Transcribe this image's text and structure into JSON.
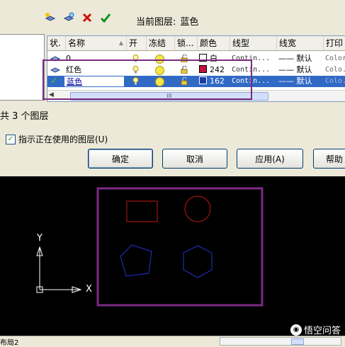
{
  "toolbar": {
    "icons": [
      "new-layer-icon",
      "new-layer-frozen-icon",
      "delete-layer-icon",
      "set-current-icon"
    ],
    "current_layer_label": "当前图层:",
    "current_layer_value": "蓝色"
  },
  "left_pane": {
    "text": ""
  },
  "grid": {
    "headers": [
      "状.",
      "名称",
      "▲",
      "开",
      "冻结",
      "锁...",
      "颜色",
      "线型",
      "线宽",
      "打印"
    ],
    "rows": [
      {
        "status": "",
        "name": "0",
        "color_name": "白",
        "color_hex": "#ffffff",
        "linetype": "Contin...",
        "lineweight": "—— 默认",
        "plot": "Color"
      },
      {
        "status": "",
        "name": "红色",
        "color_name": "242",
        "color_hex": "#c0143c",
        "linetype": "Contin...",
        "lineweight": "—— 默认",
        "plot": "Colo..."
      },
      {
        "status": "✓",
        "name": "蓝色",
        "color_name": "162",
        "color_hex": "#1c3aa8",
        "linetype": "Contin...",
        "lineweight": "—— 默认",
        "plot": "Colo..."
      }
    ],
    "scroll_thumb_label": "III"
  },
  "footer": {
    "layer_count": "共 3 个图层",
    "show_used_label": "指示正在使用的图层(U)"
  },
  "buttons": {
    "ok": "确定",
    "cancel": "取消",
    "apply": "应用(A)",
    "help": "帮助"
  },
  "drawing": {
    "axis_y": "Y",
    "axis_x": "X",
    "shapes": [
      "red-rectangle",
      "red-circle",
      "blue-pentagon",
      "blue-hexagon"
    ],
    "colors": {
      "red": "#c01818",
      "blue": "#2233cc",
      "highlight": "#7b2a83"
    }
  },
  "status_bar": {
    "layout_tab": "布局2"
  },
  "watermark": {
    "text": "悟空问答"
  }
}
